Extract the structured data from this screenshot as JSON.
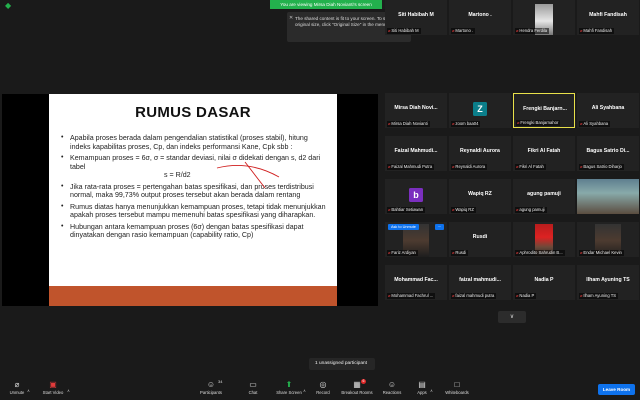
{
  "banner": {
    "viewing_text": "You are viewing Mirsa Diah Novianti's screen",
    "view_options_label": "View Options",
    "view_label": "View"
  },
  "tooltip": {
    "text": "The shared content is fit to your screen. To see the original size, click \"Original Size\" in the menu."
  },
  "slide": {
    "title": "RUMUS DASAR",
    "bullets": [
      "Apabila proses berada dalam pengendalian statistikal (proses stabil), hitung indeks kapabilitas proses, Cp, dan indeks performansi Kane, Cpk sbb :",
      "Kemampuan proses = 6σ,   σ = standar deviasi,  nilai σ didekati dengan s, d2 dari tabel",
      "Jika rata-rata proses = pertengahan batas spesifikasi, dan proses terdistribusi normal, maka 99,73% output proses tersebut akan berada dalam rentang",
      "Rumus diatas hanya menunjukkan  kemampuan proses, tetapi tidak menunjukkan apakah proses tersebut mampu memenuhi batas spesifikasi yang diharapkan.",
      "Hubungan antara kemampuan proses (6σ) dengan batas spesifikasi dapat dinyatakan dengan rasio kemampuan (capability ratio, Cp)"
    ],
    "formula": "s = R/d2",
    "accent_color": "#c0542c"
  },
  "gallery": [
    {
      "center": "Mirsa Diah Novi...",
      "caption": "Mirsa Diah Novianti"
    },
    {
      "avatar": "Z",
      "avatar_color": "#0b7e8a",
      "caption": "zoom baa04"
    },
    {
      "center": "Frengki  Banjarn...",
      "caption": "Frengki Banjarnahor",
      "active": true
    },
    {
      "center": "Ali Syahbana",
      "caption": "Ali Syahbana"
    },
    {
      "center": "Faizal  Mahmudi...",
      "caption": "Faizal Mahmudi Putra"
    },
    {
      "center": "Reynaldi Aurora",
      "caption": "Reynaldi Aurora"
    },
    {
      "center": "Fikri Al Fatah",
      "caption": "Fikri Al Fatah"
    },
    {
      "center": "Bagus Satrio Di...",
      "caption": "Bagus Satrio Diharjo"
    },
    {
      "avatar": "b",
      "avatar_color": "#7b2fbf",
      "caption": "Bahtiar Setiawan"
    },
    {
      "center": "Wapiq RZ",
      "caption": "Wapiq RZ"
    },
    {
      "center": "agung pamuji",
      "caption": "agung pamuji"
    },
    {
      "photo": "sea",
      "caption": ""
    },
    {
      "photo": "dark",
      "caption": "Fariz Ardiyan",
      "ask_label": "Ask to Unmute",
      "menu": "···"
    },
    {
      "center": "Rusdi",
      "caption": "Rusdi"
    },
    {
      "photo": "red",
      "caption": "Aphrodito Sahrudin B..."
    },
    {
      "photo": "dark",
      "caption": "Endar Michael Kevin"
    },
    {
      "center": "Mohammad  Fac...",
      "caption": "Mohammad Fachrul ..."
    },
    {
      "center": "faizal  mahmudi...",
      "caption": "faizal mahmudi putra"
    },
    {
      "center": "Nadia P",
      "caption": "Nadia P"
    },
    {
      "center": "Ilham Ayuning TS",
      "caption": "Ilham Ayuning TS"
    },
    {
      "center": "Siti Habibah M",
      "caption": "Siti Habibah M"
    },
    {
      "center": "Martono .",
      "caption": "Martono ."
    },
    {
      "photo": "gray",
      "caption": "Hendra Ferdila"
    },
    {
      "center": "Mahfi Fandisah",
      "caption": "Mahfi Fandisah"
    }
  ],
  "unassigned": "1 unassigned participant",
  "toolbar": {
    "unmute": "Unmute",
    "start_video": "Start Video",
    "participants": "Participants",
    "participants_count": "34",
    "chat": "Chat",
    "share_screen": "Share Screen",
    "record": "Record",
    "breakout_rooms": "Breakout Rooms",
    "breakout_badge": "6",
    "reactions": "Reactions",
    "apps": "Apps",
    "whiteboards": "Whiteboards",
    "leave": "Leave Room"
  }
}
